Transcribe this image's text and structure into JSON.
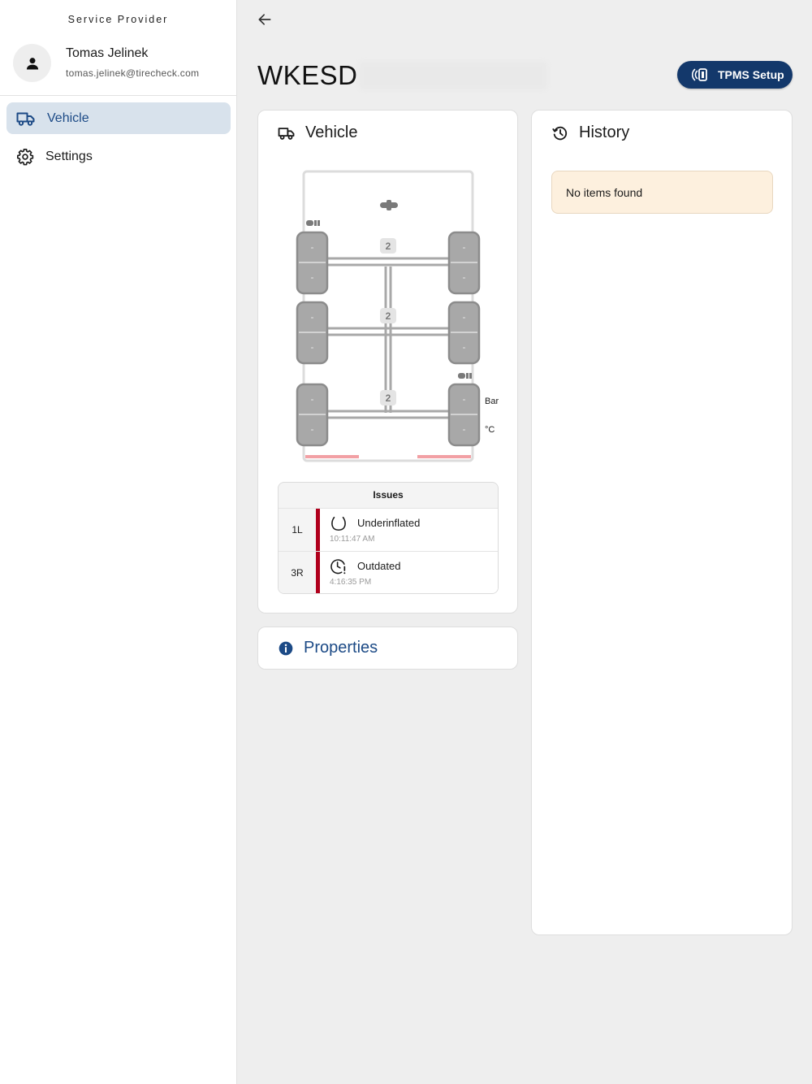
{
  "sidebar": {
    "provider_title": "Service Provider",
    "user": {
      "name": "Tomas Jelinek",
      "email": "tomas.jelinek@tirecheck.com"
    },
    "nav": [
      {
        "label": "Vehicle",
        "icon": "truck-icon",
        "active": true
      },
      {
        "label": "Settings",
        "icon": "gear-icon",
        "active": false
      }
    ]
  },
  "header": {
    "title_prefix": "WKESD",
    "tpms_button": "TPMS Setup",
    "back_icon": "arrow-left-icon"
  },
  "vehicle_card": {
    "title": "Vehicle",
    "diagram": {
      "axles": [
        {
          "label": "2",
          "left_tire": [
            "-",
            "-"
          ],
          "right_tire": [
            "-",
            "-"
          ]
        },
        {
          "label": "2",
          "left_tire": [
            "-",
            "-"
          ],
          "right_tire": [
            "-",
            "-"
          ]
        },
        {
          "label": "2",
          "left_tire": [
            "-",
            "-"
          ],
          "right_tire": [
            "-",
            "-"
          ]
        }
      ],
      "unit_pressure": "Bar",
      "unit_temperature": "°C"
    },
    "issues": {
      "title": "Issues",
      "rows": [
        {
          "position": "1L",
          "label": "Underinflated",
          "time": "10:11:47 AM",
          "icon": "tire-underinflated-icon"
        },
        {
          "position": "3R",
          "label": "Outdated",
          "time": "4:16:35 PM",
          "icon": "clock-alert-icon"
        }
      ]
    }
  },
  "properties_card": {
    "title": "Properties"
  },
  "history_card": {
    "title": "History",
    "empty_message": "No items found"
  },
  "colors": {
    "primary": "#13386b",
    "accent_text": "#1c4a86",
    "nav_active_bg": "#d8e2ec",
    "issue_bar": "#b0001c",
    "empty_bg": "#fdf0de",
    "tire": "#a8a8a8"
  }
}
